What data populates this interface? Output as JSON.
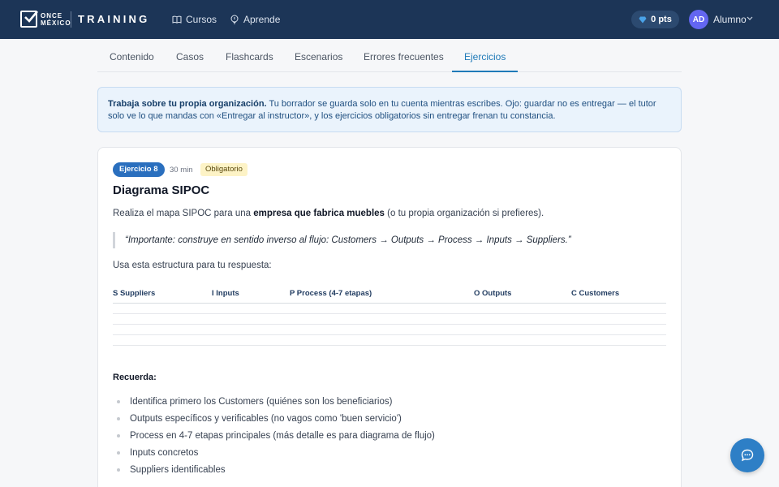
{
  "header": {
    "logo_top": "ONCE",
    "logo_bottom": "MÉXICO",
    "brand": "TRAINING",
    "nav": [
      {
        "label": "Cursos",
        "icon": "book-icon"
      },
      {
        "label": "Aprende",
        "icon": "lightbulb-icon"
      }
    ],
    "points": "0 pts",
    "avatar_initials": "AD",
    "user_name": "Alumno"
  },
  "tabs": [
    {
      "label": "Contenido",
      "active": false
    },
    {
      "label": "Casos",
      "active": false
    },
    {
      "label": "Flashcards",
      "active": false
    },
    {
      "label": "Escenarios",
      "active": false
    },
    {
      "label": "Errores frecuentes",
      "active": false
    },
    {
      "label": "Ejercicios",
      "active": true
    }
  ],
  "info": {
    "strong": "Trabaja sobre tu propia organización.",
    "text": " Tu borrador se guarda solo en tu cuenta mientras escribes. Ojo: guardar no es entregar — el tutor solo ve lo que mandas con «Entregar al instructor», y los ejercicios obligatorios sin entregar frenan tu constancia."
  },
  "exercise": {
    "badge": "Ejercicio 8",
    "time": "30 min",
    "required": "Obligatorio",
    "title": "Diagrama SIPOC",
    "desc_pre": "Realiza el mapa SIPOC para una ",
    "desc_bold": "empresa que fabrica muebles",
    "desc_post": " (o tu propia organización si prefieres).",
    "quote": "“Importante: construye en sentido inverso al flujo: Customers → Outputs → Process → Inputs → Suppliers.”",
    "use_structure": "Usa esta estructura para tu respuesta:",
    "table_headers": [
      "S Suppliers",
      "I Inputs",
      "P Process (4-7 etapas)",
      "O Outputs",
      "C Customers"
    ],
    "remember": "Recuerda:",
    "tips": [
      "Identifica primero los Customers (quiénes son los beneficiarios)",
      "Outputs específicos y verificables (no vagos como 'buen servicio')",
      "Process en 4-7 etapas principales (más detalle es para diagrama de flujo)",
      "Inputs concretos",
      "Suppliers identificables"
    ]
  },
  "colors": {
    "header_bg": "#1c3557",
    "accent": "#1f7ab8",
    "badge": "#2a6fbe",
    "avatar": "#6366f1"
  }
}
